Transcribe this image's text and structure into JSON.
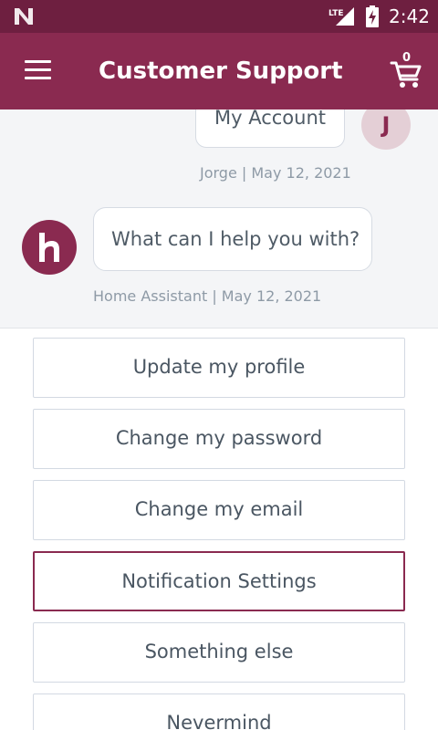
{
  "status_bar": {
    "network_label": "LTE",
    "time": "2:42",
    "icons": [
      "n-logo-icon",
      "lte-signal-icon",
      "battery-charging-icon"
    ]
  },
  "app_bar": {
    "title": "Customer Support",
    "menu_icon": "hamburger-menu-icon",
    "cart_icon": "shopping-cart-icon",
    "cart_count": "0"
  },
  "chat": {
    "user_message": {
      "text": "My Account",
      "avatar_initial": "J",
      "meta": "Jorge | May 12, 2021"
    },
    "bot_message": {
      "text": "What can I help you with?",
      "avatar_icon": "home-assistant-logo-icon",
      "meta": "Home Assistant | May 12, 2021"
    }
  },
  "options": [
    {
      "label": "Update my profile",
      "selected": false
    },
    {
      "label": "Change my password",
      "selected": false
    },
    {
      "label": "Change my email",
      "selected": false
    },
    {
      "label": "Notification Settings",
      "selected": true
    },
    {
      "label": "Something else",
      "selected": false
    },
    {
      "label": "Nevermind",
      "selected": false
    }
  ],
  "colors": {
    "status_bar": "#6e1f40",
    "brand": "#8a2a50",
    "chat_background": "#f4f5f7",
    "avatar_user_bg": "#e4cfd6"
  }
}
